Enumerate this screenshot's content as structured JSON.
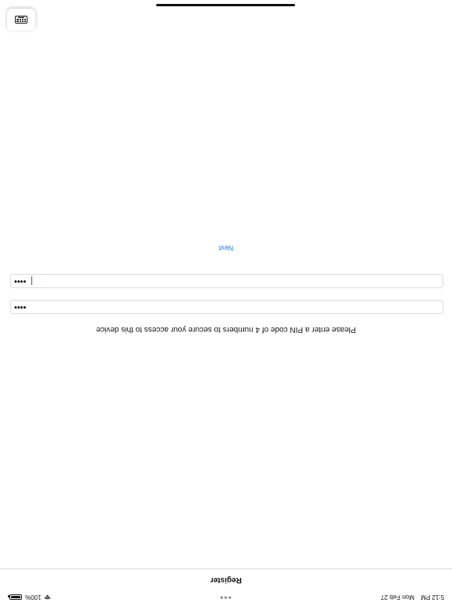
{
  "status_bar": {
    "time": "5:12 PM",
    "date": "Mon Feb 27",
    "dots": "•••",
    "battery": "100%",
    "wifi_icon": "wifi-icon",
    "battery_icon": "battery-icon"
  },
  "nav": {
    "title": "Register"
  },
  "form": {
    "instruction": "Please enter a PIN code of 4 numbers to secure your access to this device",
    "pin_value": "••••",
    "pin_confirm_value": "••••",
    "next_label": "Next"
  },
  "keyboard": {
    "icon": "keyboard-icon"
  },
  "colors": {
    "accent": "#1a7ae8",
    "text": "#111111",
    "border": "#dcdcdc"
  }
}
